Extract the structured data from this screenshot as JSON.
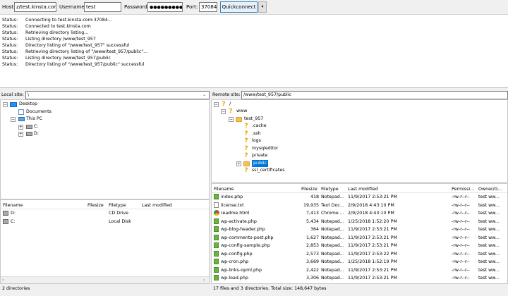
{
  "quickconnect": {
    "host_label": "Host:",
    "host_value": "z/test.kinsta.com",
    "username_label": "Username:",
    "username_value": "test",
    "password_label": "Password:",
    "password_value": "●●●●●●●●●●●",
    "port_label": "Port:",
    "port_value": "37084",
    "button_label": "Quickconnect",
    "dropdown_icon": "▾"
  },
  "log": [
    {
      "k": "Status:",
      "v": "Connecting to test.kinsta.com:37084..."
    },
    {
      "k": "Status:",
      "v": "Connected to test.kinsta.com"
    },
    {
      "k": "Status:",
      "v": "Retrieving directory listing..."
    },
    {
      "k": "Status:",
      "v": "Listing directory /www/test_957"
    },
    {
      "k": "Status:",
      "v": "Directory listing of \"/www/test_957\" successful"
    },
    {
      "k": "Status:",
      "v": "Retrieving directory listing of \"/www/test_957/public\"..."
    },
    {
      "k": "Status:",
      "v": "Listing directory /www/test_957/public"
    },
    {
      "k": "Status:",
      "v": "Directory listing of \"/www/test_957/public\" successful"
    }
  ],
  "local": {
    "site_label": "Local site:",
    "site_path": "\\",
    "tree": {
      "desktop": "Desktop",
      "documents": "Documents",
      "this_pc": "This PC",
      "c": "C:",
      "d": "D:"
    },
    "columns": [
      "Filename",
      "Filesize",
      "Filetype",
      "Last modified"
    ],
    "rows": [
      {
        "name": "D:",
        "size": "",
        "type": "CD Drive",
        "modified": ""
      },
      {
        "name": "C:",
        "size": "",
        "type": "Local Disk",
        "modified": ""
      }
    ],
    "status": "2 directories"
  },
  "remote": {
    "site_label": "Remote site:",
    "site_path": "/www/test_957/public",
    "tree": {
      "root": "/",
      "www": "www",
      "test": "test_957",
      "children": [
        ".cache",
        ".ssh",
        "logs",
        "mysqleditor",
        "private",
        "public",
        "ssl_certificates"
      ]
    },
    "columns": [
      "Filename",
      "Filesize",
      "Filetype",
      "Last modified",
      "Permissi...",
      "Owner/G..."
    ],
    "rows": [
      {
        "icon": "php",
        "name": "index.php",
        "size": "418",
        "type": "Notepad...",
        "modified": "11/9/2017 2:53:21 PM",
        "perm": "-rw-r--r--",
        "owner": "test ww..."
      },
      {
        "icon": "txt",
        "name": "license.txt",
        "size": "19,935",
        "type": "Text Doc...",
        "modified": "2/9/2018 4:43:10 PM",
        "perm": "-rw-r--r--",
        "owner": "test ww..."
      },
      {
        "icon": "chrome",
        "name": "readme.html",
        "size": "7,413",
        "type": "Chrome ...",
        "modified": "2/9/2018 4:43:10 PM",
        "perm": "-rw-r--r--",
        "owner": "test ww..."
      },
      {
        "icon": "php",
        "name": "wp-activate.php",
        "size": "5,434",
        "type": "Notepad...",
        "modified": "1/25/2018 1:52:20 PM",
        "perm": "-rw-r--r--",
        "owner": "test ww..."
      },
      {
        "icon": "php",
        "name": "wp-blog-header.php",
        "size": "364",
        "type": "Notepad...",
        "modified": "11/9/2017 2:53:21 PM",
        "perm": "-rw-r--r--",
        "owner": "test ww..."
      },
      {
        "icon": "php",
        "name": "wp-comments-post.php",
        "size": "1,627",
        "type": "Notepad...",
        "modified": "11/9/2017 2:53:21 PM",
        "perm": "-rw-r--r--",
        "owner": "test ww..."
      },
      {
        "icon": "php",
        "name": "wp-config-sample.php",
        "size": "2,853",
        "type": "Notepad...",
        "modified": "11/9/2017 2:53:21 PM",
        "perm": "-rw-r--r--",
        "owner": "test ww..."
      },
      {
        "icon": "php",
        "name": "wp-config.php",
        "size": "2,573",
        "type": "Notepad...",
        "modified": "11/9/2017 2:53:22 PM",
        "perm": "-rw-r--r--",
        "owner": "test ww..."
      },
      {
        "icon": "php",
        "name": "wp-cron.php",
        "size": "3,669",
        "type": "Notepad...",
        "modified": "1/25/2018 1:52:19 PM",
        "perm": "-rw-r--r--",
        "owner": "test ww..."
      },
      {
        "icon": "php",
        "name": "wp-links-opml.php",
        "size": "2,422",
        "type": "Notepad...",
        "modified": "11/9/2017 2:53:21 PM",
        "perm": "-rw-r--r--",
        "owner": "test ww..."
      },
      {
        "icon": "php",
        "name": "wp-load.php",
        "size": "3,306",
        "type": "Notepad...",
        "modified": "11/9/2017 2:53:21 PM",
        "perm": "-rw-r--r--",
        "owner": "test ww..."
      }
    ],
    "status": "17 files and 3 directories. Total size: 148,647 bytes"
  },
  "colors": {
    "accent": "#0078d7",
    "folder": "#f3c15a",
    "question": "#e6a700"
  }
}
